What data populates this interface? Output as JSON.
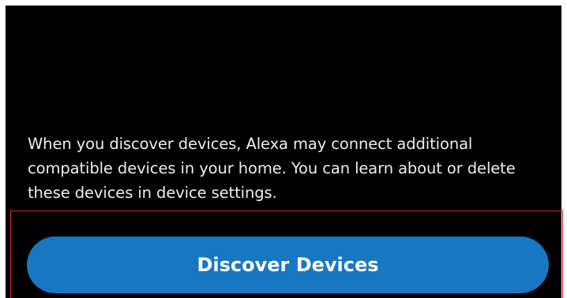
{
  "discovery": {
    "info_text": "When you discover devices, Alexa may connect additional compatible devices in your home. You can learn about or delete these devices in device settings.",
    "button_label": "Discover Devices"
  },
  "colors": {
    "background": "#000000",
    "button": "#1777c3",
    "highlight_border": "#d6262b"
  }
}
